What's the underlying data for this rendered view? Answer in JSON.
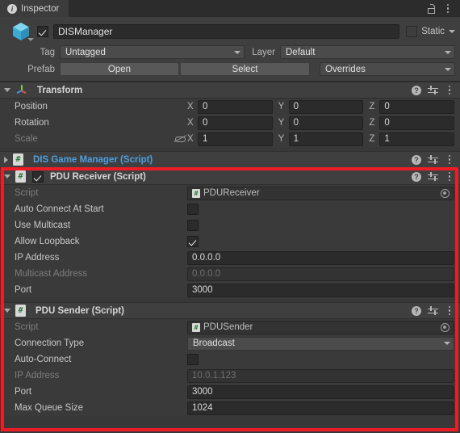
{
  "window": {
    "tab_label": "Inspector",
    "tab_icon": "info-icon",
    "lock_icon": "lock-open-icon",
    "menu_icon": "kebab-menu-icon"
  },
  "object_header": {
    "prefab_icon": "prefab-cube-icon",
    "enabled": true,
    "name": "DISManager",
    "static_label": "Static",
    "tag_label": "Tag",
    "tag_value": "Untagged",
    "layer_label": "Layer",
    "layer_value": "Default",
    "prefab_label": "Prefab",
    "open_button": "Open",
    "select_button": "Select",
    "overrides_button": "Overrides"
  },
  "components": [
    {
      "title": "Transform",
      "icon": "transform-gizmo-icon",
      "expanded": true,
      "rows": [
        {
          "label": "Position",
          "x": "0",
          "y": "0",
          "z": "0"
        },
        {
          "label": "Rotation",
          "x": "0",
          "y": "0",
          "z": "0"
        },
        {
          "label": "Scale",
          "x": "1",
          "y": "1",
          "z": "1",
          "link_icon": "constrained-proportions-off-icon"
        }
      ],
      "axis_labels": {
        "x": "X",
        "y": "Y",
        "z": "Z"
      }
    },
    {
      "title": "DIS Game Manager (Script)",
      "icon": "cs-script-icon",
      "expanded": false
    },
    {
      "title": "PDU Receiver (Script)",
      "icon": "cs-script-icon",
      "expanded": true,
      "enabled": true,
      "fields": [
        {
          "label": "Script",
          "type": "object",
          "value": "PDUReceiver",
          "disabled": true
        },
        {
          "label": "Auto Connect At Start",
          "type": "checkbox",
          "checked": false
        },
        {
          "label": "Use Multicast",
          "type": "checkbox",
          "checked": false
        },
        {
          "label": "Allow Loopback",
          "type": "checkbox",
          "checked": true
        },
        {
          "label": "IP Address",
          "type": "text",
          "value": "0.0.0.0",
          "disabled": false
        },
        {
          "label": "Multicast Address",
          "type": "text",
          "value": "0.0.0.0",
          "disabled": true
        },
        {
          "label": "Port",
          "type": "text",
          "value": "3000",
          "disabled": false
        }
      ]
    },
    {
      "title": "PDU Sender (Script)",
      "icon": "cs-script-icon",
      "expanded": true,
      "fields": [
        {
          "label": "Script",
          "type": "object",
          "value": "PDUSender",
          "disabled": true
        },
        {
          "label": "Connection Type",
          "type": "dropdown",
          "value": "Broadcast"
        },
        {
          "label": "Auto-Connect",
          "type": "checkbox",
          "checked": false
        },
        {
          "label": "IP Address",
          "type": "text",
          "value": "10.0.1.123",
          "disabled": true
        },
        {
          "label": "Port",
          "type": "text",
          "value": "3000",
          "disabled": false
        },
        {
          "label": "Max Queue Size",
          "type": "text",
          "value": "1024",
          "disabled": false
        }
      ]
    }
  ],
  "header_icons": {
    "help": "?",
    "preset": "preset-settings-icon",
    "menu": "kebab-menu-icon"
  },
  "annotation": {
    "highlight_color": "#ee1c25",
    "name": "red-highlight-box"
  }
}
